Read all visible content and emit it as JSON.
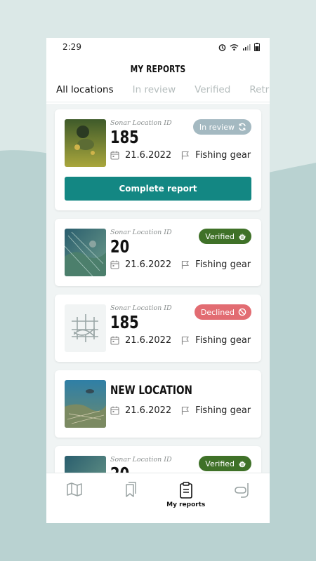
{
  "status": {
    "time": "2:29"
  },
  "header": {
    "title": "MY REPORTS"
  },
  "tabs": [
    {
      "label": "All locations",
      "active": true
    },
    {
      "label": "In review",
      "active": false
    },
    {
      "label": "Verified",
      "active": false
    },
    {
      "label": "Retri",
      "active": false
    }
  ],
  "reports": [
    {
      "subtitle": "Sonar Location ID",
      "id": "185",
      "date": "21.6.2022",
      "category": "Fishing gear",
      "status": "In review",
      "status_icon": "refresh-icon",
      "action": "Complete report",
      "thumb": "diver-photo"
    },
    {
      "subtitle": "Sonar Location ID",
      "id": "20",
      "date": "21.6.2022",
      "category": "Fishing gear",
      "status": "Verified",
      "status_icon": "hand-icon",
      "thumb": "reef-photo"
    },
    {
      "subtitle": "Sonar Location ID",
      "id": "185",
      "date": "21.6.2022",
      "category": "Fishing gear",
      "status": "Declined",
      "status_icon": "block-icon",
      "thumb": "fish-net-placeholder"
    },
    {
      "subtitle": "",
      "id": "NEW LOCATION",
      "date": "21.6.2022",
      "category": "Fishing gear",
      "status": "",
      "thumb": "seabed-photo"
    },
    {
      "subtitle": "Sonar Location ID",
      "id": "20",
      "date": "",
      "category": "",
      "status": "Verified",
      "status_icon": "hand-icon",
      "thumb": "reef-photo"
    }
  ],
  "nav": [
    {
      "icon": "map-icon",
      "label": ""
    },
    {
      "icon": "bookmarks-icon",
      "label": ""
    },
    {
      "icon": "clipboard-icon",
      "label": "My reports",
      "active": true
    },
    {
      "icon": "snorkel-icon",
      "label": ""
    }
  ],
  "colors": {
    "accent": "#138783",
    "in_review": "#a4b9c1",
    "verified": "#3f7128",
    "declined": "#e26c72",
    "background": "#dbe8e7"
  }
}
